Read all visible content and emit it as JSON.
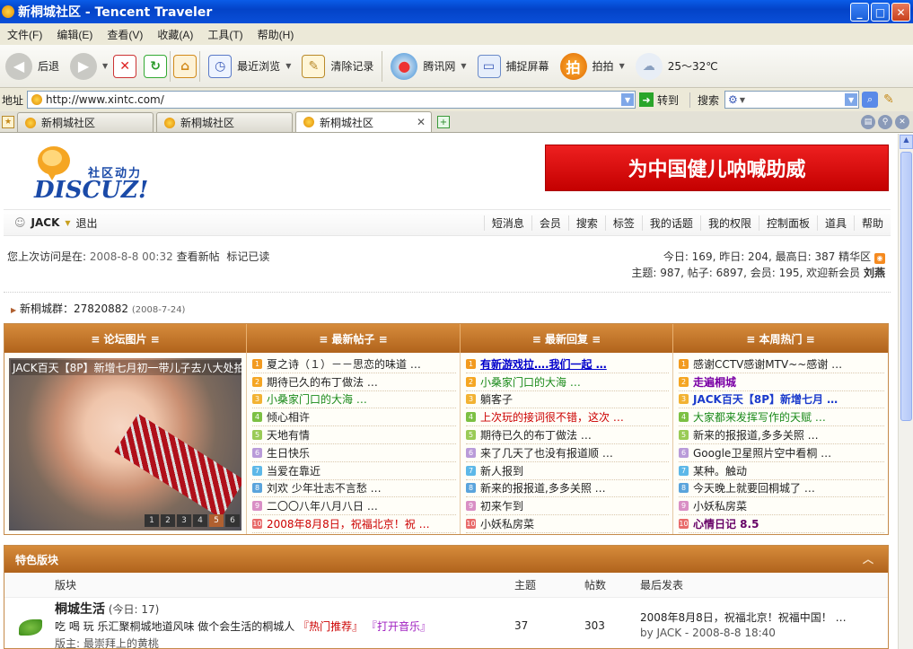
{
  "window": {
    "title": "新桐城社区 - Tencent Traveler",
    "min": "_",
    "max": "□",
    "close": "✕"
  },
  "menu": [
    "文件(F)",
    "编辑(E)",
    "查看(V)",
    "收藏(A)",
    "工具(T)",
    "帮助(H)"
  ],
  "toolbar": {
    "back": "后退",
    "recent": "最近浏览",
    "clear": "清除记录",
    "tencent": "腾讯网",
    "capture": "捕捉屏幕",
    "snap": "拍拍",
    "weather": "25～32℃"
  },
  "address": {
    "label": "地址",
    "url": "http://www.xintc.com/",
    "go": "转到",
    "search": "搜索"
  },
  "tabs": [
    "新桐城社区",
    "新桐城社区",
    "新桐城社区"
  ],
  "logo": {
    "cn": "社区动力",
    "en": "DISCUZ!"
  },
  "banner": {
    "text": "为中国健儿呐喊助威"
  },
  "user": {
    "name": "JACK",
    "logout": "退出"
  },
  "nav": [
    "短消息",
    "会员",
    "搜索",
    "标签",
    "我的话题",
    "我的权限",
    "控制面板",
    "道具",
    "帮助"
  ],
  "visit": {
    "prefix": "您上次访问是在:",
    "time": "2008-8-8 00:32",
    "new_posts": "查看新帖",
    "mark_read": "标记已读"
  },
  "stats": {
    "line1": "今日: 169, 昨日: 204, 最高日: 387 精华区",
    "line2_prefix": "主题: 987, 帖子: 6897, 会员: 195, 欢迎新会员",
    "new_member": "刘燕"
  },
  "group": {
    "text": "新桐城群：27820882",
    "date": "(2008-7-24)"
  },
  "panel": {
    "headers": [
      "≡ 论坛图片 ≡",
      "≡ 最新帖子 ≡",
      "≡ 最新回复 ≡",
      "≡ 本周热门 ≡"
    ],
    "photo_caption": "JACK百天【8P】新增七月初一带儿子去八大处拍",
    "pager": [
      "1",
      "2",
      "3",
      "4",
      "5",
      "6"
    ],
    "new_posts": [
      {
        "n": "1",
        "t": "夏之诗（１）－－思恋的味道 …"
      },
      {
        "n": "2",
        "t": "期待已久的布丁做法 …"
      },
      {
        "n": "3",
        "t": "小桑家门口的大海 …"
      },
      {
        "n": "4",
        "t": "倾心相许"
      },
      {
        "n": "5",
        "t": "天地有情"
      },
      {
        "n": "6",
        "t": "生日快乐"
      },
      {
        "n": "7",
        "t": "当爱在靠近"
      },
      {
        "n": "8",
        "t": "刘欢 少年壮志不言愁 …"
      },
      {
        "n": "9",
        "t": "二〇〇八年八月八日 …"
      },
      {
        "n": "10",
        "t": "2008年8月8日，祝福北京！祝 …"
      }
    ],
    "new_replies": [
      {
        "n": "1",
        "t": "有新游戏拉….我们一起 …"
      },
      {
        "n": "2",
        "t": "小桑家门口的大海 …"
      },
      {
        "n": "3",
        "t": "躺客子"
      },
      {
        "n": "4",
        "t": "上次玩的接词很不错，这次 …"
      },
      {
        "n": "5",
        "t": "期待已久的布丁做法 …"
      },
      {
        "n": "6",
        "t": "来了几天了也没有报道顺 …"
      },
      {
        "n": "7",
        "t": "新人报到"
      },
      {
        "n": "8",
        "t": "新来的报报道,多多关照 …"
      },
      {
        "n": "9",
        "t": "初来乍到"
      },
      {
        "n": "10",
        "t": "小妖私房菜"
      }
    ],
    "hot": [
      {
        "n": "1",
        "t": "感谢CCTV感谢MTV~~感谢 …"
      },
      {
        "n": "2",
        "t": "走遍桐城"
      },
      {
        "n": "3",
        "t": "JACK百天【8P】新增七月 …"
      },
      {
        "n": "4",
        "t": "大家都来发挥写作的天赋 …"
      },
      {
        "n": "5",
        "t": "新来的报报道,多多关照 …"
      },
      {
        "n": "6",
        "t": "Google卫星照片空中看桐 …"
      },
      {
        "n": "7",
        "t": "某种。触动"
      },
      {
        "n": "8",
        "t": "今天晚上就要回桐城了 …"
      },
      {
        "n": "9",
        "t": "小妖私房菜"
      },
      {
        "n": "10",
        "t": "心情日记 8.5"
      }
    ]
  },
  "featured": {
    "title": "特色版块",
    "cols": {
      "forum": "版块",
      "topics": "主题",
      "posts": "帖数",
      "last": "最后发表"
    },
    "row": {
      "name": "桐城生活",
      "today": "(今日: 17)",
      "desc": "吃 喝 玩 乐汇聚桐城地道风味 做个会生活的桐城人",
      "tag1": "『热门推荐』",
      "tag2": "『打开音乐』",
      "mod": "版主: 最崇拜上的黄桃",
      "topics": "37",
      "posts": "303",
      "last_title": "2008年8月8日，祝福北京！祝福中国！ …",
      "last_by": "by JACK - 2008-8-8 18:40"
    }
  }
}
